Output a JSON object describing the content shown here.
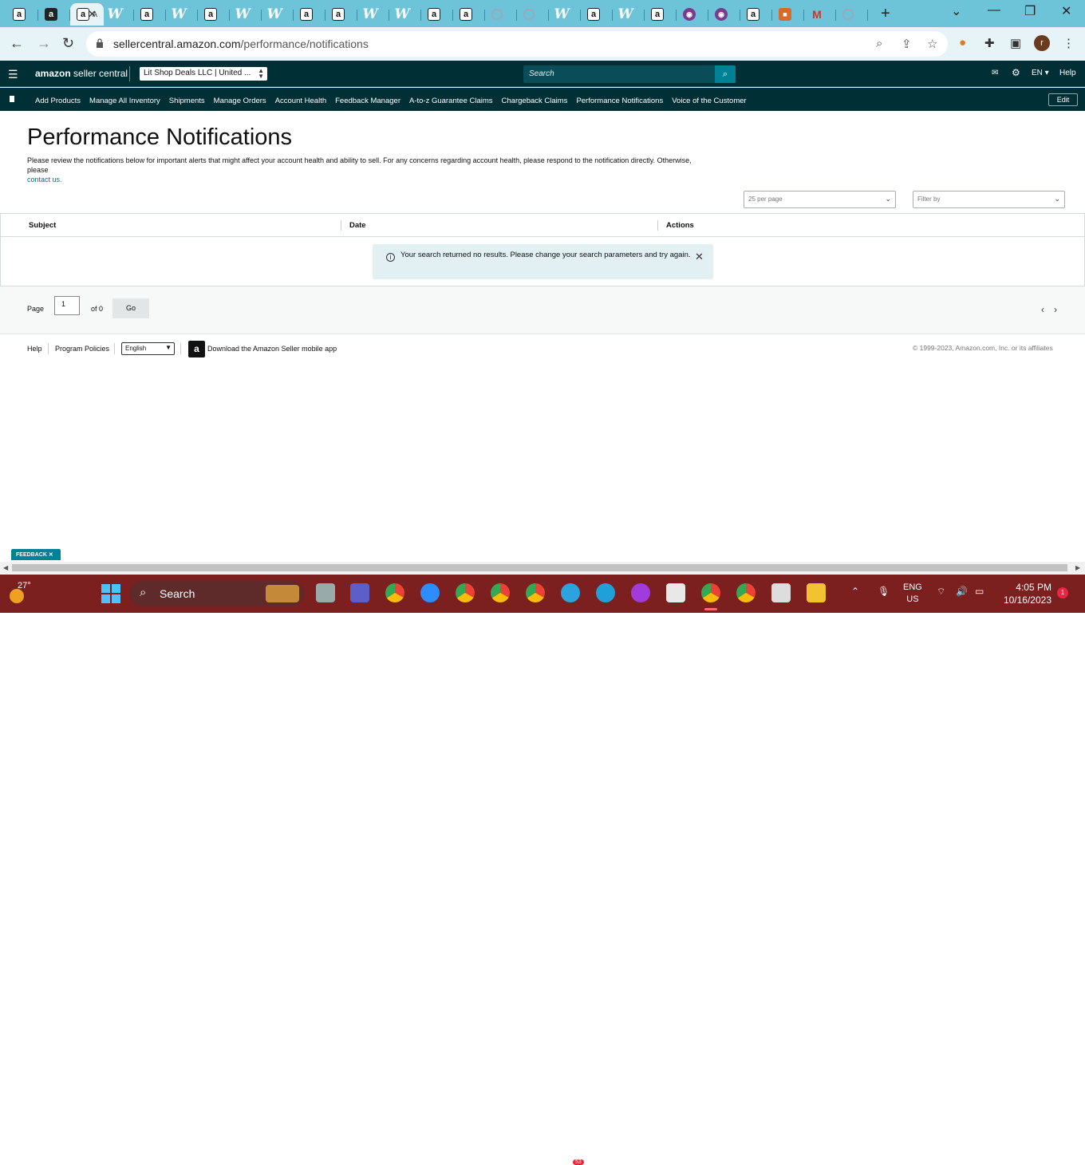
{
  "browser": {
    "url_host": "sellercentral.amazon.com",
    "url_path": "/performance/notifications",
    "active_tab_label": "A",
    "tab_favicons": [
      "a",
      "ab",
      "active",
      "w",
      "a",
      "w",
      "a",
      "w",
      "w",
      "a",
      "a",
      "w",
      "w",
      "a",
      "a",
      "g",
      "g",
      "w",
      "a",
      "w",
      "a",
      "p",
      "p",
      "a",
      "c",
      "m",
      "g"
    ]
  },
  "header": {
    "logo_text_bold": "amazon",
    "logo_text": " seller central",
    "account": "Lit Shop Deals LLC | United ...",
    "search_placeholder": "Search",
    "language": "EN",
    "help": "Help"
  },
  "nav": {
    "items": [
      "Add Products",
      "Manage All Inventory",
      "Shipments",
      "Manage Orders",
      "Account Health",
      "Feedback Manager",
      "A-to-z Guarantee Claims",
      "Chargeback Claims",
      "Performance Notifications",
      "Voice of the Customer"
    ],
    "edit": "Edit"
  },
  "page": {
    "title": "Performance Notifications",
    "intro": "Please review the notifications below for important alerts that might affect your account health and ability to sell. For any concerns regarding account health, please respond to the notification directly. Otherwise, please",
    "intro_link": "contact us.",
    "per_page": "25 per page",
    "filter_placeholder": "Filter by"
  },
  "table": {
    "columns": [
      "Subject",
      "Date",
      "Actions"
    ],
    "empty_message": "Your search returned no results. Please change your search parameters and try again."
  },
  "pager": {
    "page_label": "Page",
    "current_page": "1",
    "of_label": "of 0",
    "go": "Go"
  },
  "footer": {
    "help": "Help",
    "program_policies": "Program Policies",
    "language": "English",
    "download_app": "Download the Amazon Seller mobile app",
    "copyright": "© 1999-2023, Amazon.com, Inc. or its affiliates"
  },
  "feedback": "FEEDBACK",
  "taskbar": {
    "temperature": "27°",
    "search": "Search",
    "telegram_badge": "53",
    "lang_top": "ENG",
    "lang_bottom": "US",
    "time": "4:05 PM",
    "date": "10/16/2023",
    "notifications": "1"
  },
  "colors": {
    "header_bg": "#002f36",
    "accent": "#008296",
    "link": "#007185",
    "tabstrip": "#6dc4d9",
    "taskbar": "#7b1f1f"
  }
}
